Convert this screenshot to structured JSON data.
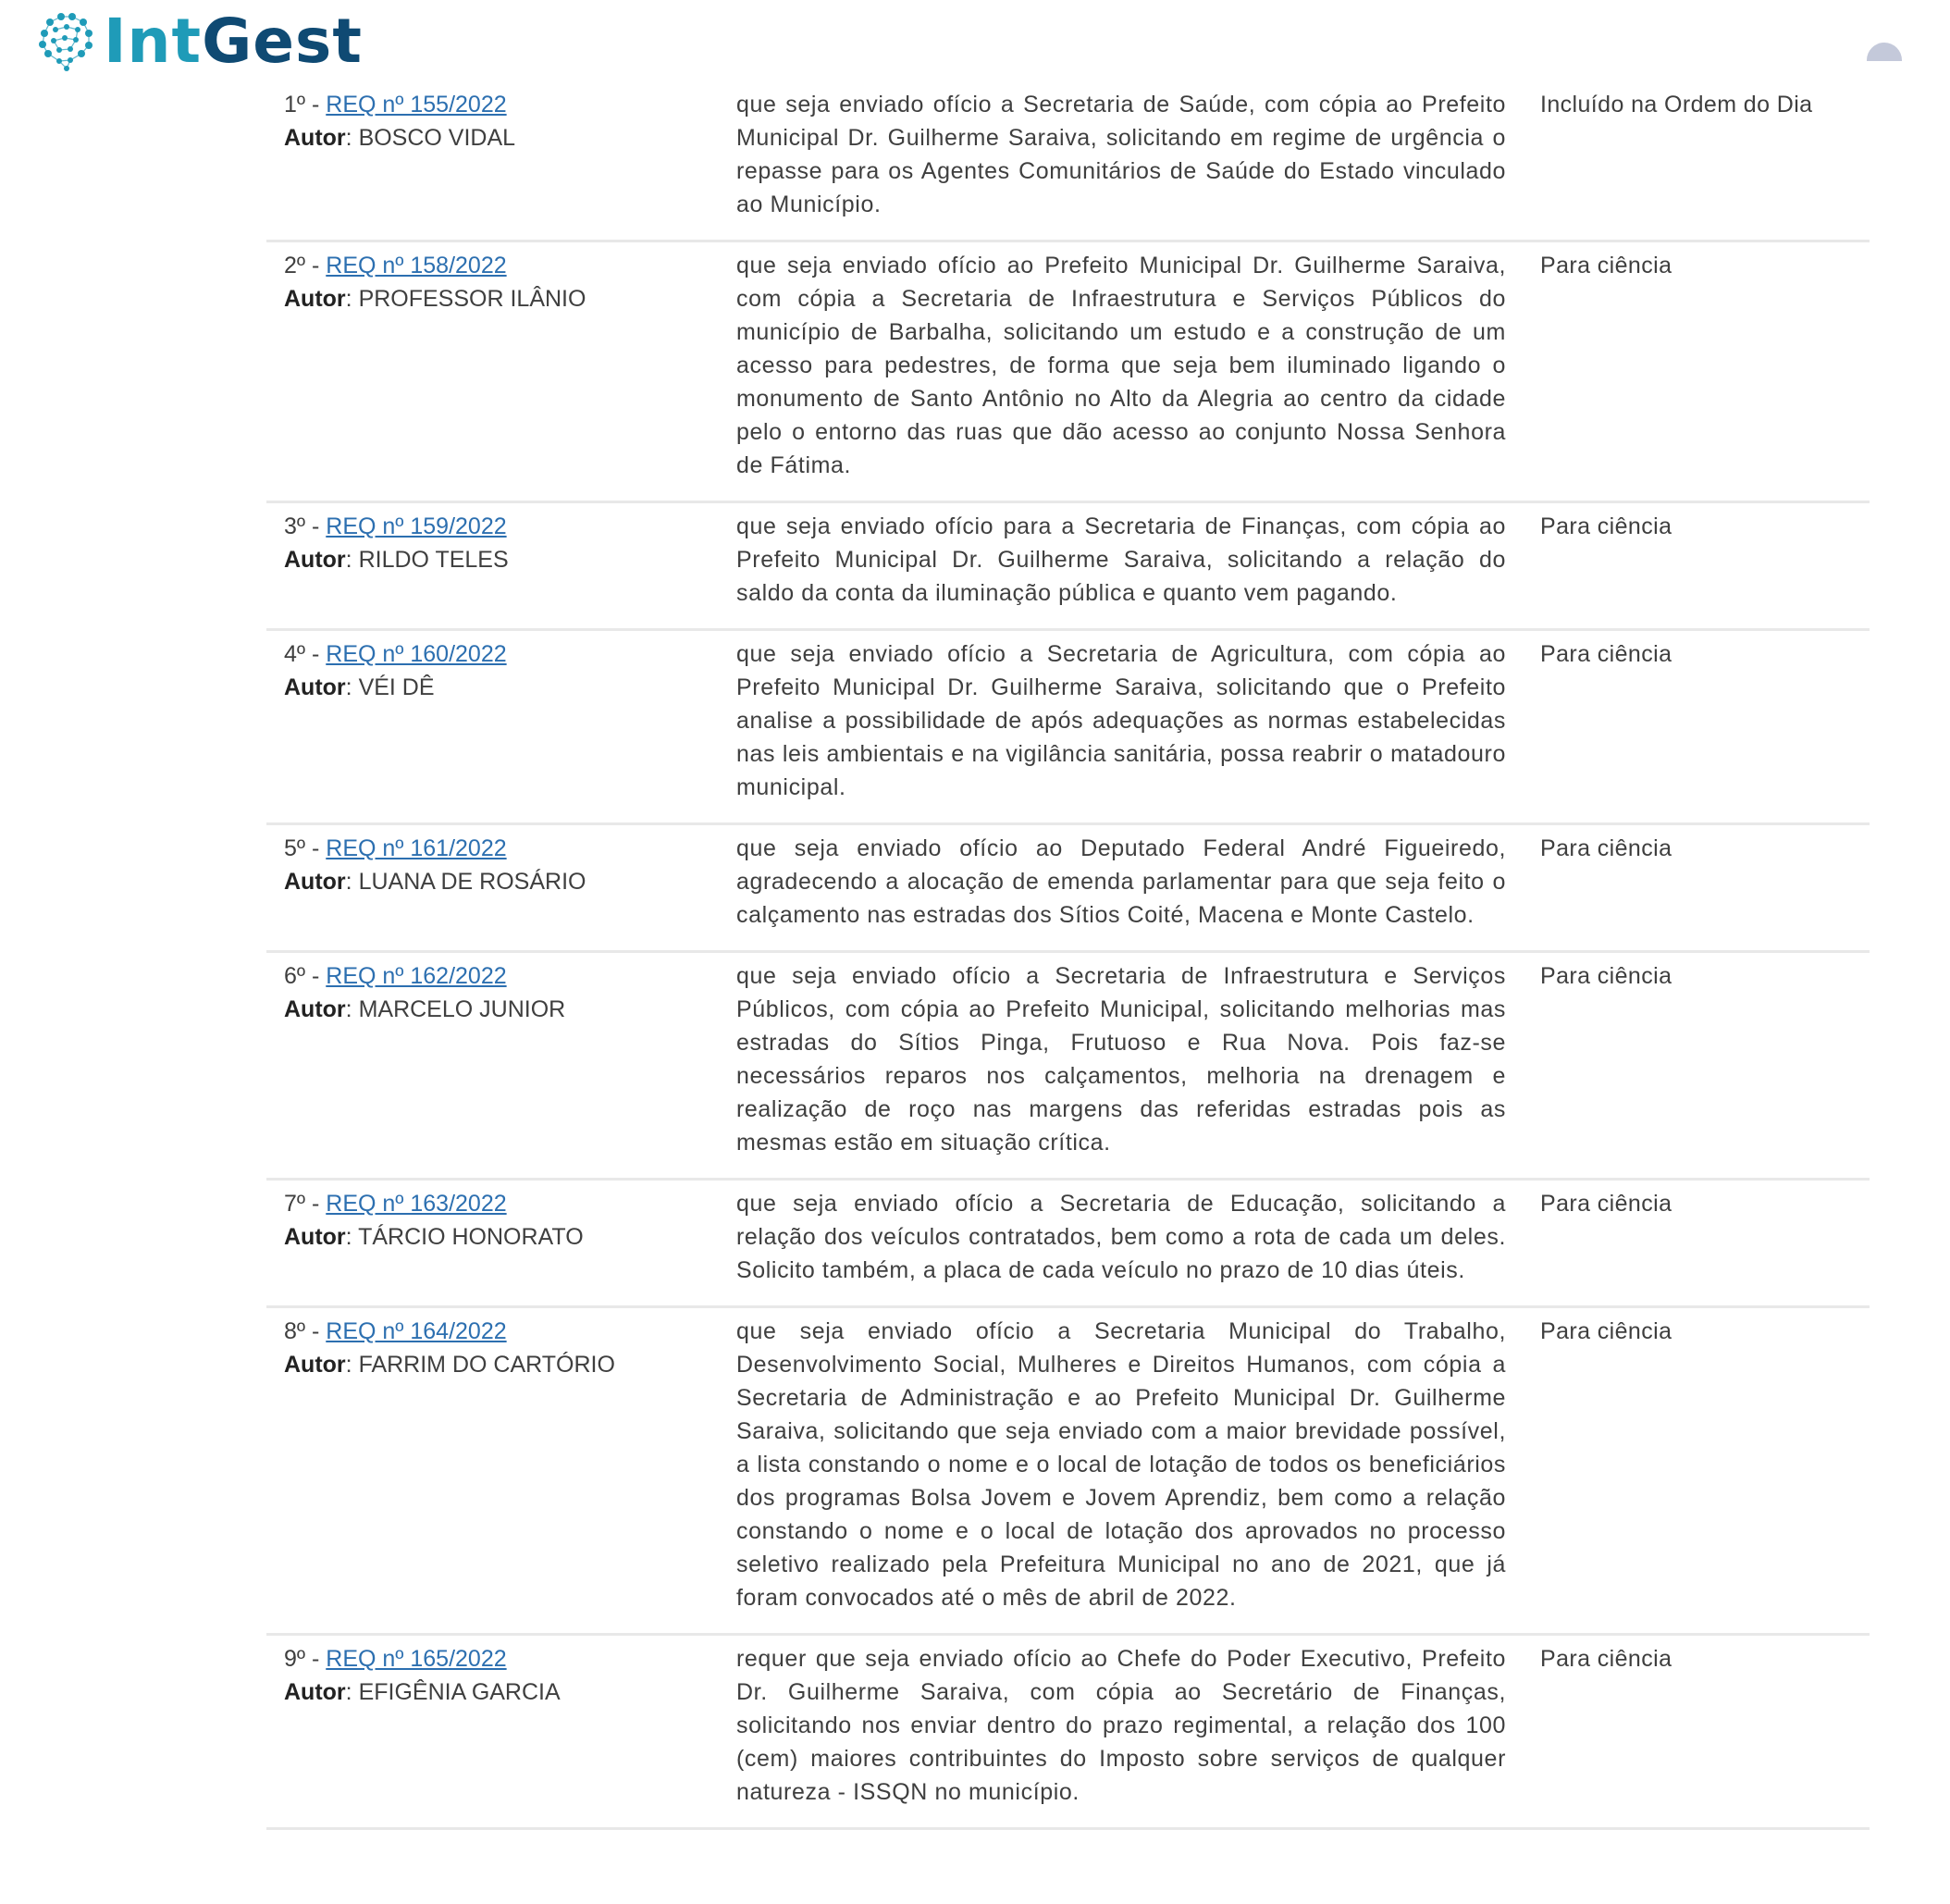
{
  "brand": {
    "part1": "Int",
    "part2": "Gest",
    "icon": "brain-network-icon",
    "color_dark": "#0f4a73",
    "color_accent": "#1f9bb8"
  },
  "header": {
    "avatar_icon": "user-avatar-icon"
  },
  "labels": {
    "separator": " - ",
    "author": "Autor",
    "author_sep": ": "
  },
  "rows": [
    {
      "order": "1º",
      "req": "REQ nº 155/2022",
      "author": "BOSCO VIDAL",
      "description": "que seja enviado ofício a Secretaria de Saúde, com cópia ao Prefeito Municipal Dr. Guilherme Saraiva, solicitando em regime de urgência o repasse para os Agentes Comunitários de Saúde do Estado vinculado ao Município.",
      "status": "Incluído na Ordem do Dia"
    },
    {
      "order": "2º",
      "req": "REQ nº 158/2022",
      "author": "PROFESSOR ILÂNIO",
      "description": "que seja enviado ofício ao Prefeito Municipal Dr. Guilherme Saraiva, com cópia a Secretaria de Infraestrutura e Serviços Públicos do município de Barbalha, solicitando um estudo e a construção de um acesso para pedestres, de forma que seja bem iluminado ligando o monumento de Santo Antônio no Alto da Alegria ao centro da cidade pelo o entorno das ruas que dão acesso ao conjunto Nossa Senhora de Fátima.",
      "status": "Para ciência"
    },
    {
      "order": "3º",
      "req": "REQ nº 159/2022",
      "author": "RILDO TELES",
      "description": "que seja enviado ofício para a Secretaria de Finanças, com cópia ao Prefeito Municipal Dr. Guilherme Saraiva, solicitando a relação do saldo da conta da iluminação pública e quanto vem pagando.",
      "status": "Para ciência"
    },
    {
      "order": "4º",
      "req": "REQ nº 160/2022",
      "author": "VÉI DÊ",
      "description": "que seja enviado ofício a Secretaria de Agricultura, com cópia ao Prefeito Municipal Dr. Guilherme Saraiva, solicitando que o Prefeito analise a possibilidade de após adequações as normas estabelecidas nas leis ambientais e na vigilância sanitária, possa reabrir o matadouro municipal.",
      "status": "Para ciência"
    },
    {
      "order": "5º",
      "req": "REQ nº 161/2022",
      "author": "LUANA DE ROSÁRIO",
      "description": "que seja enviado ofício ao Deputado Federal André Figueiredo, agradecendo a alocação de emenda parlamentar para que seja feito o calçamento nas estradas dos Sítios Coité, Macena e Monte Castelo.",
      "status": "Para ciência"
    },
    {
      "order": "6º",
      "req": "REQ nº 162/2022",
      "author": "MARCELO JUNIOR",
      "description": "que seja enviado ofício a Secretaria de Infraestrutura e Serviços Públicos, com cópia ao Prefeito Municipal, solicitando melhorias mas estradas do Sítios Pinga, Frutuoso e Rua Nova. Pois faz-se necessários reparos nos calçamentos, melhoria na drenagem e realização de roço nas margens das referidas estradas pois as mesmas estão em situação crítica.",
      "status": "Para ciência"
    },
    {
      "order": "7º",
      "req": "REQ nº 163/2022",
      "author": "TÁRCIO HONORATO",
      "description": "que seja enviado ofício a Secretaria de Educação, solicitando a relação dos veículos contratados, bem como a rota de cada um deles. Solicito também, a placa de cada veículo no prazo de 10 dias úteis.",
      "status": "Para ciência"
    },
    {
      "order": "8º",
      "req": "REQ nº 164/2022",
      "author": "FARRIM DO CARTÓRIO",
      "description": "que seja enviado ofício a Secretaria Municipal do Trabalho, Desenvolvimento Social, Mulheres e Direitos Humanos, com cópia a Secretaria de Administração e ao Prefeito Municipal Dr. Guilherme Saraiva, solicitando que seja enviado com a maior brevidade possível, a lista constando o nome e o local de lotação de todos os beneficiários dos programas Bolsa Jovem e Jovem Aprendiz, bem como a relação constando o nome e o local de lotação dos aprovados no processo seletivo realizado pela Prefeitura Municipal no ano de 2021, que já foram convocados até o mês de abril de 2022.",
      "status": "Para ciência"
    },
    {
      "order": "9º",
      "req": "REQ nº 165/2022",
      "author": "EFIGÊNIA GARCIA",
      "description": "requer que seja enviado ofício ao Chefe do Poder Executivo, Prefeito Dr. Guilherme Saraiva, com cópia ao Secretário de Finanças, solicitando nos enviar dentro do prazo regimental, a relação dos 100 (cem) maiores contribuintes do Imposto sobre serviços de qualquer natureza - ISSQN no município.",
      "status": "Para ciência"
    }
  ]
}
